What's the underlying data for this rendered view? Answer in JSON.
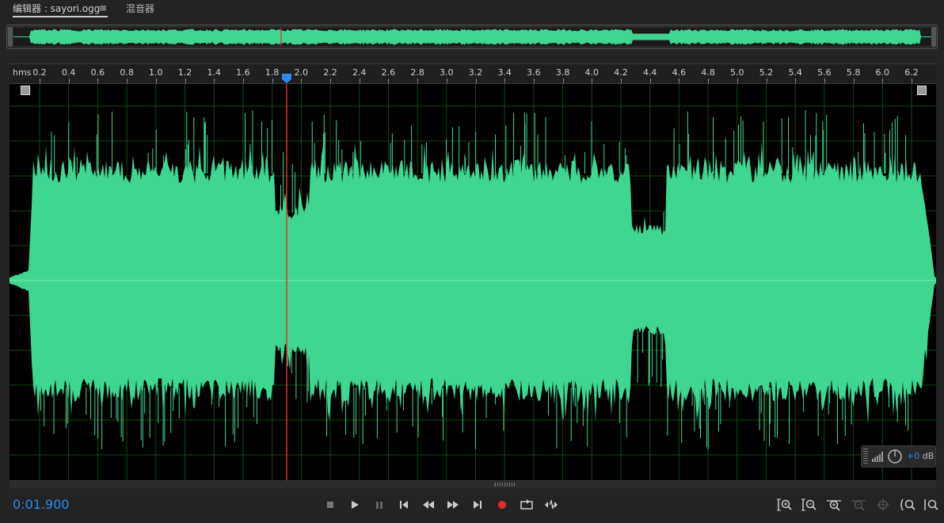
{
  "tabs": {
    "editor_label": "编辑器 : sayori.ogg",
    "menu_icon": "≡",
    "mixer_label": "混音器"
  },
  "ruler": {
    "unit_label": "hms",
    "ticks": [
      "0.2",
      "0.4",
      "0.6",
      "0.8",
      "1.0",
      "1.2",
      "1.4",
      "1.6",
      "1.8",
      "2.0",
      "2.2",
      "2.4",
      "2.6",
      "2.8",
      "3.0",
      "3.2",
      "3.4",
      "3.6",
      "3.8",
      "4.0",
      "4.2",
      "4.4",
      "4.6",
      "4.8",
      "5.0",
      "5.2",
      "5.4",
      "5.6",
      "5.8",
      "6.0",
      "6.2"
    ]
  },
  "playhead": {
    "time_seconds": 1.9
  },
  "colors": {
    "waveform": "#3fd692",
    "playhead": "#e03030",
    "grid": "#0f4a0f",
    "time_display": "#2d8ceb"
  },
  "transport": {
    "time_display": "0:01.900",
    "buttons": [
      "stop-icon",
      "play-icon",
      "pause-icon",
      "go-to-start-icon",
      "rewind-icon",
      "fast-forward-icon",
      "go-to-end-icon",
      "record-icon",
      "loop-playback-icon",
      "skip-selection-icon"
    ]
  },
  "gain": {
    "value": "+0",
    "unit": "dB"
  },
  "zoom": {
    "buttons": [
      "zoom-in-amplitude-icon",
      "zoom-out-amplitude-icon",
      "zoom-in-time-icon",
      "zoom-out-time-icon",
      "zoom-selection-icon",
      "zoom-in-left-icon",
      "zoom-out-full-icon"
    ]
  }
}
